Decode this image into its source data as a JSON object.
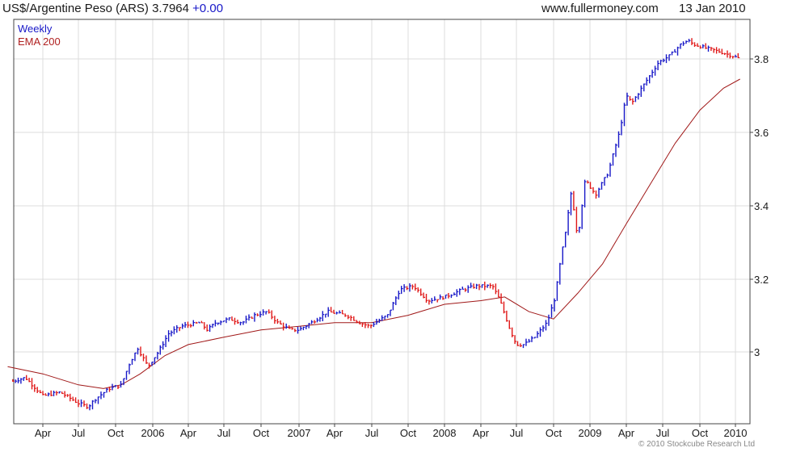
{
  "header": {
    "instrument": "US$/Argentine Peso (ARS)",
    "last": "3.7964",
    "change": "+0.00",
    "site": "www.fullermoney.com",
    "date": "13 Jan 2010"
  },
  "legend": {
    "period": "Weekly",
    "ma": "EMA 200"
  },
  "copyright": "© 2010 Stockcube Research Ltd",
  "colors": {
    "up": "#1818c8",
    "down": "#e01818",
    "ema": "#a01818",
    "grid": "#dcdcdc"
  },
  "chart_data": {
    "type": "line",
    "x_tick_labels": [
      "Apr",
      "Jul",
      "Oct",
      "2006",
      "Apr",
      "Jul",
      "Oct",
      "2007",
      "Apr",
      "Jul",
      "Oct",
      "2008",
      "Apr",
      "Jul",
      "Oct",
      "2009",
      "Apr",
      "Jul",
      "Oct",
      "2010"
    ],
    "y_tick_labels": [
      "3",
      "3.2",
      "3.4",
      "3.6",
      "3.8"
    ],
    "ylim": [
      2.82,
      3.9
    ],
    "series": [
      {
        "name": "Weekly",
        "x": [
          "2005-01-14",
          "2005-02-15",
          "2005-04-01",
          "2005-05-15",
          "2005-07-01",
          "2005-07-25",
          "2005-08-10",
          "2005-09-15",
          "2005-10-15",
          "2005-11-05",
          "2005-11-25",
          "2005-12-20",
          "2006-01-15",
          "2006-02-10",
          "2006-03-15",
          "2006-05-01",
          "2006-05-20",
          "2006-06-10",
          "2006-07-15",
          "2006-08-15",
          "2006-09-15",
          "2006-10-15",
          "2006-11-10",
          "2006-12-10",
          "2006-12-31",
          "2007-02-01",
          "2007-03-15",
          "2007-05-01",
          "2007-06-01",
          "2007-06-25",
          "2007-07-10",
          "2007-08-10",
          "2007-09-10",
          "2007-10-15",
          "2007-11-20",
          "2008-01-01",
          "2008-02-15",
          "2008-03-20",
          "2008-05-01",
          "2008-05-20",
          "2008-06-15",
          "2008-07-01",
          "2008-07-20",
          "2008-08-15",
          "2008-09-15",
          "2008-10-05",
          "2008-10-20",
          "2008-11-01",
          "2008-11-15",
          "2008-12-01",
          "2008-12-20",
          "2009-01-15",
          "2009-02-15",
          "2009-03-15",
          "2009-04-01",
          "2009-04-15",
          "2009-05-15",
          "2009-06-20",
          "2009-07-20",
          "2009-08-15",
          "2009-09-01",
          "2009-09-15",
          "2009-10-15",
          "2009-11-20",
          "2009-12-20",
          "2010-01-13"
        ],
        "values": [
          2.92,
          2.93,
          2.88,
          2.89,
          2.86,
          2.85,
          2.87,
          2.9,
          2.91,
          2.97,
          3.01,
          2.96,
          3.0,
          3.05,
          3.07,
          3.08,
          3.06,
          3.08,
          3.09,
          3.08,
          3.1,
          3.11,
          3.08,
          3.06,
          3.06,
          3.08,
          3.11,
          3.1,
          3.08,
          3.07,
          3.08,
          3.1,
          3.17,
          3.18,
          3.14,
          3.15,
          3.17,
          3.18,
          3.18,
          3.14,
          3.06,
          3.02,
          3.02,
          3.04,
          3.08,
          3.15,
          3.26,
          3.33,
          3.44,
          3.31,
          3.47,
          3.43,
          3.49,
          3.6,
          3.7,
          3.68,
          3.73,
          3.79,
          3.81,
          3.84,
          3.85,
          3.84,
          3.83,
          3.82,
          3.81,
          3.8
        ]
      },
      {
        "name": "EMA 200",
        "x": [
          "2005-01-01",
          "2005-04-01",
          "2005-07-01",
          "2005-09-01",
          "2005-10-15",
          "2005-12-01",
          "2006-02-01",
          "2006-04-01",
          "2006-07-01",
          "2006-10-01",
          "2007-01-01",
          "2007-04-01",
          "2007-07-01",
          "2007-10-01",
          "2008-01-01",
          "2008-04-01",
          "2008-06-01",
          "2008-08-01",
          "2008-10-01",
          "2008-12-01",
          "2009-02-01",
          "2009-04-01",
          "2009-06-01",
          "2009-08-01",
          "2009-10-01",
          "2009-12-01",
          "2010-01-13"
        ],
        "values": [
          2.96,
          2.94,
          2.91,
          2.9,
          2.91,
          2.94,
          2.99,
          3.02,
          3.04,
          3.06,
          3.07,
          3.08,
          3.08,
          3.1,
          3.13,
          3.14,
          3.15,
          3.11,
          3.09,
          3.16,
          3.24,
          3.35,
          3.46,
          3.57,
          3.66,
          3.72,
          3.745
        ]
      }
    ],
    "grid": true,
    "legend_position": "top-left"
  }
}
